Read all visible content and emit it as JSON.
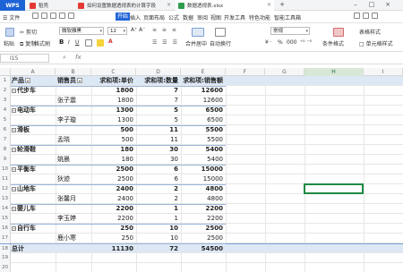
{
  "titlebar": {
    "app": "WPS",
    "tabs": [
      {
        "label": "稻壳"
      },
      {
        "label": "如何设置数据透视表的计算字段"
      },
      {
        "label": "数据透视表.xlsx"
      }
    ]
  },
  "menu": {
    "file": "文件",
    "start": "开始",
    "items": [
      "插入",
      "页面布局",
      "公式",
      "数据",
      "审阅",
      "视图",
      "开发工具",
      "特色功能",
      "智能工具箱"
    ]
  },
  "toolbar": {
    "paste": "粘贴",
    "cut": "剪切",
    "copy": "复制",
    "format_painter": "格式刷",
    "font": "微软雅黑",
    "font_size": "12",
    "merge": "合并居中",
    "wrap": "自动换行",
    "number_format": "常规",
    "percent": "%",
    "thousands": "000",
    "cond_format": "条件格式",
    "cell_style": "表格样式"
  },
  "formula": {
    "cell_ref": "I15",
    "fx": "fx"
  },
  "columns": [
    "A",
    "B",
    "C",
    "D",
    "E",
    "F",
    "G",
    "H",
    "I"
  ],
  "selected_column": "H",
  "pivot": {
    "headers": {
      "product": "产品",
      "seller": "销售员",
      "price": "求和项:单价",
      "qty": "求和项:数量",
      "amount": "求和项:销售额"
    },
    "rows": [
      {
        "num": "1",
        "a": "产品",
        "b": "销售员",
        "c": "求和项:单价",
        "d": "求和项:数量",
        "e": "求和项:销售额",
        "type": "header"
      },
      {
        "num": "2",
        "a": "代步车",
        "b": "",
        "c": "1800",
        "d": "7",
        "e": "12600",
        "type": "group"
      },
      {
        "num": "3",
        "a": "",
        "b": "张子震",
        "c": "1800",
        "d": "7",
        "e": "12600",
        "type": "item"
      },
      {
        "num": "4",
        "a": "电动车",
        "b": "",
        "c": "1300",
        "d": "5",
        "e": "6500",
        "type": "group"
      },
      {
        "num": "5",
        "a": "",
        "b": "李子璇",
        "c": "1300",
        "d": "5",
        "e": "6500",
        "type": "item"
      },
      {
        "num": "6",
        "a": "滑板",
        "b": "",
        "c": "500",
        "d": "11",
        "e": "5500",
        "type": "group"
      },
      {
        "num": "7",
        "a": "",
        "b": "孟晓",
        "c": "500",
        "d": "11",
        "e": "5500",
        "type": "item"
      },
      {
        "num": "8",
        "a": "轮滑鞋",
        "b": "",
        "c": "180",
        "d": "30",
        "e": "5400",
        "type": "group"
      },
      {
        "num": "9",
        "a": "",
        "b": "姚晨",
        "c": "180",
        "d": "30",
        "e": "5400",
        "type": "item"
      },
      {
        "num": "10",
        "a": "平衡车",
        "b": "",
        "c": "2500",
        "d": "6",
        "e": "15000",
        "type": "group"
      },
      {
        "num": "11",
        "a": "",
        "b": "狄迹",
        "c": "2500",
        "d": "6",
        "e": "15000",
        "type": "item"
      },
      {
        "num": "12",
        "a": "山地车",
        "b": "",
        "c": "2400",
        "d": "2",
        "e": "4800",
        "type": "group"
      },
      {
        "num": "13",
        "a": "",
        "b": "张馨月",
        "c": "2400",
        "d": "2",
        "e": "4800",
        "type": "item"
      },
      {
        "num": "14",
        "a": "婴儿车",
        "b": "",
        "c": "2200",
        "d": "1",
        "e": "2200",
        "type": "group"
      },
      {
        "num": "15",
        "a": "",
        "b": "李玉婷",
        "c": "2200",
        "d": "1",
        "e": "2200",
        "type": "item"
      },
      {
        "num": "16",
        "a": "自行车",
        "b": "",
        "c": "250",
        "d": "10",
        "e": "2500",
        "type": "group"
      },
      {
        "num": "17",
        "a": "",
        "b": "鹿小寒",
        "c": "250",
        "d": "10",
        "e": "2500",
        "type": "item"
      },
      {
        "num": "18",
        "a": "总计",
        "b": "",
        "c": "11130",
        "d": "72",
        "e": "54500",
        "type": "total"
      },
      {
        "num": "19",
        "a": "",
        "b": "",
        "c": "",
        "d": "",
        "e": "",
        "type": "empty"
      },
      {
        "num": "20",
        "a": "",
        "b": "",
        "c": "",
        "d": "",
        "e": "",
        "type": "empty"
      }
    ]
  },
  "colors": {
    "accent": "#1e63d6",
    "pivot_header": "#dde8f5",
    "selection": "#1e8a45"
  }
}
